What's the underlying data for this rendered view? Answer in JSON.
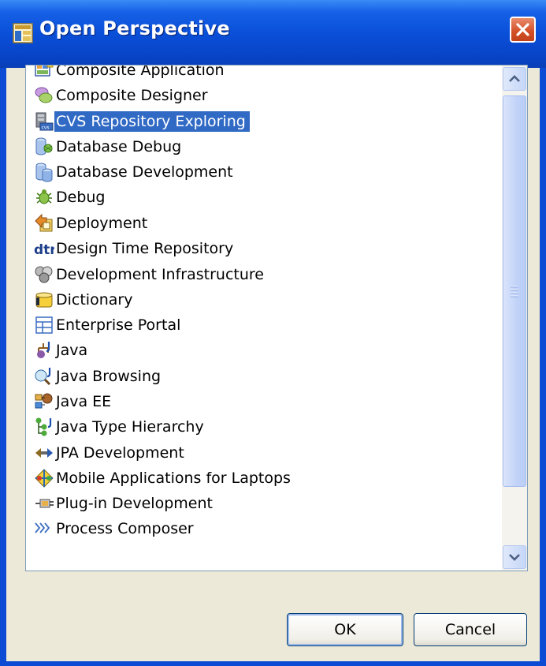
{
  "window": {
    "title": "Open Perspective",
    "close_icon": "close-icon",
    "accent": "#0a4fd8"
  },
  "list": {
    "selected_index": 2,
    "selection_color": "#316ac5",
    "items": [
      {
        "label": "Composite Application",
        "icon": "composite-application-icon"
      },
      {
        "label": "Composite Designer",
        "icon": "composite-designer-icon"
      },
      {
        "label": "CVS Repository Exploring",
        "icon": "cvs-repository-icon"
      },
      {
        "label": "Database Debug",
        "icon": "database-debug-icon"
      },
      {
        "label": "Database Development",
        "icon": "database-development-icon"
      },
      {
        "label": "Debug",
        "icon": "bug-icon"
      },
      {
        "label": "Deployment",
        "icon": "deployment-icon"
      },
      {
        "label": "Design Time Repository",
        "icon": "dtr-icon"
      },
      {
        "label": "Development Infrastructure",
        "icon": "development-infrastructure-icon"
      },
      {
        "label": "Dictionary",
        "icon": "dictionary-icon"
      },
      {
        "label": "Enterprise Portal",
        "icon": "enterprise-portal-icon"
      },
      {
        "label": "Java",
        "icon": "java-icon"
      },
      {
        "label": "Java Browsing",
        "icon": "java-browsing-icon"
      },
      {
        "label": "Java EE",
        "icon": "java-ee-icon"
      },
      {
        "label": "Java Type Hierarchy",
        "icon": "java-type-hierarchy-icon"
      },
      {
        "label": "JPA Development",
        "icon": "jpa-icon"
      },
      {
        "label": "Mobile Applications for Laptops",
        "icon": "mobile-applications-icon"
      },
      {
        "label": "Plug-in Development",
        "icon": "plugin-icon"
      },
      {
        "label": "Process Composer",
        "icon": "process-composer-icon"
      }
    ]
  },
  "buttons": {
    "ok_label": "OK",
    "cancel_label": "Cancel"
  }
}
